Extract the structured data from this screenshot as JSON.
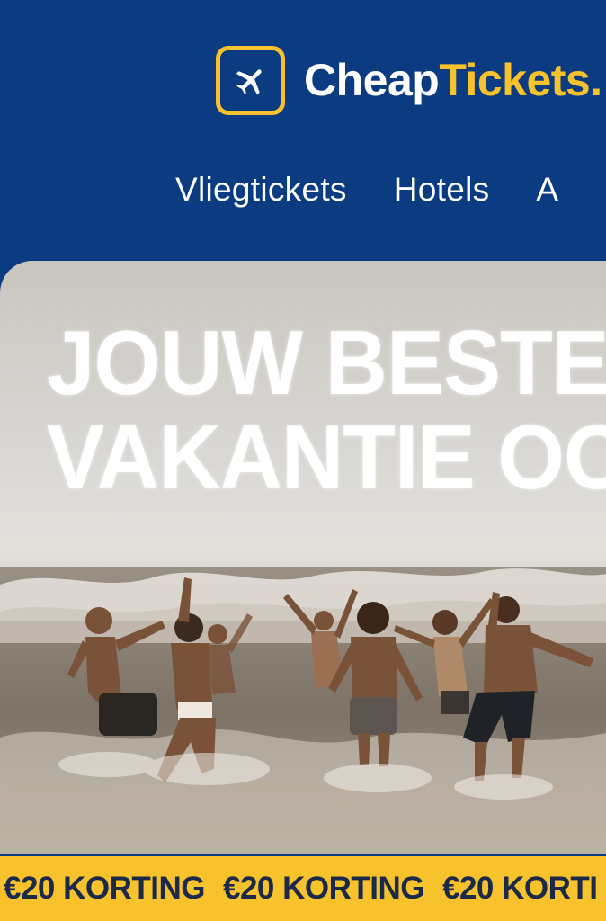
{
  "brand": {
    "name_part1": "Cheap",
    "name_part2": "Tickets",
    "suffix": ".",
    "logo_icon": "airplane-icon",
    "accent_color": "#f7c22b",
    "header_color": "#0b3c82"
  },
  "nav": {
    "items": [
      {
        "label": "Vliegtickets"
      },
      {
        "label": "Hotels"
      },
      {
        "label": "A"
      }
    ]
  },
  "hero": {
    "title_line1": "JOUW BESTE",
    "title_line2": "VAKANTIE OOI"
  },
  "promo": {
    "items": [
      {
        "label": "€20 KORTING"
      },
      {
        "label": "€20 KORTING"
      },
      {
        "label": "€20 KORTI"
      }
    ]
  }
}
